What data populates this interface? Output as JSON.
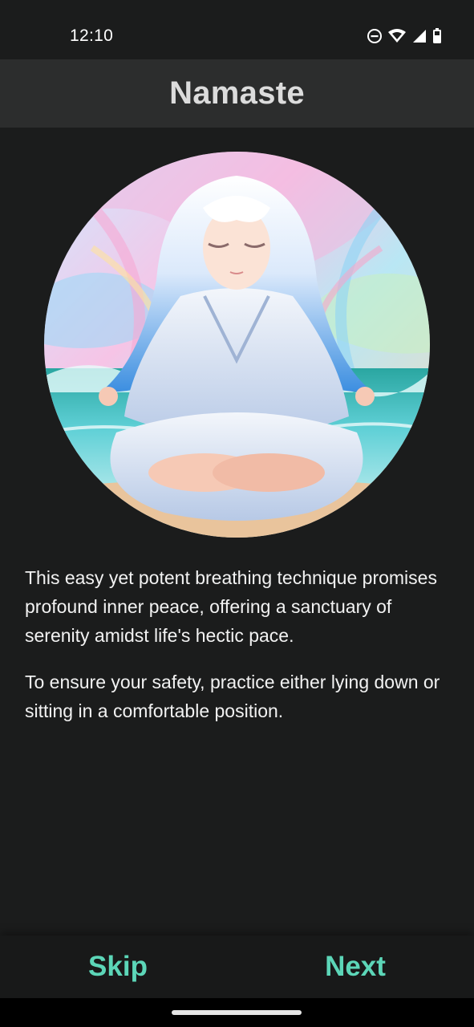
{
  "status_bar": {
    "time": "12:10",
    "icons": [
      "do-not-disturb-icon",
      "wifi-icon",
      "signal-icon",
      "battery-icon"
    ]
  },
  "app_bar": {
    "title": "Namaste"
  },
  "hero": {
    "image": "meditation-illustration"
  },
  "content": {
    "paragraphs": [
      "This easy yet potent breathing technique promises profound inner peace, offering a sanctuary of serenity amidst life's hectic pace.",
      "To ensure your safety, practice either lying down or sitting in a comfortable position."
    ]
  },
  "bottom_bar": {
    "skip_label": "Skip",
    "next_label": "Next"
  },
  "colors": {
    "background": "#1b1c1c",
    "app_bar": "#2c2d2d",
    "title": "#dcdcdc",
    "accent": "#5cd6b8"
  }
}
